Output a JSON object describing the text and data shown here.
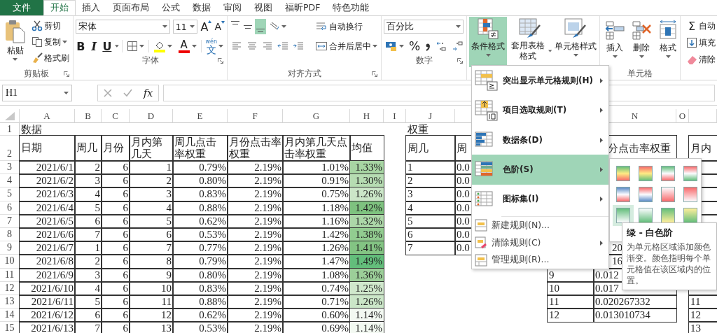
{
  "tabs": [
    {
      "label": "文件",
      "kind": "file",
      "selected": false
    },
    {
      "label": "开始",
      "selected": true
    },
    {
      "label": "插入",
      "selected": false
    },
    {
      "label": "页面布局",
      "selected": false
    },
    {
      "label": "公式",
      "selected": false
    },
    {
      "label": "数据",
      "selected": false
    },
    {
      "label": "审阅",
      "selected": false
    },
    {
      "label": "视图",
      "selected": false
    },
    {
      "label": "福昕PDF",
      "selected": false
    },
    {
      "label": "特色功能",
      "selected": false
    }
  ],
  "clipboard": {
    "paste": "粘贴",
    "cut": "剪切",
    "copy": "复制",
    "painter": "格式刷",
    "label": "剪贴板"
  },
  "font": {
    "name": "宋体",
    "size": "11",
    "grow": "A",
    "shrink": "A",
    "bold": "B",
    "italic": "I",
    "underline": "U",
    "color_letter": "A",
    "phonetic_top": "wén",
    "phonetic_main": "文",
    "label": "字体"
  },
  "alignment": {
    "wrap": "自动换行",
    "merge": "合并后居中",
    "label": "对齐方式"
  },
  "number": {
    "format": "百分比",
    "percent": "%",
    "label": "数字"
  },
  "styles": {
    "conditional": {
      "label": "条件格式",
      "selected": true
    },
    "table_format": "套用表格格式",
    "cell_styles": "单元格样式"
  },
  "cells": {
    "insert": "插入",
    "delete": "删除",
    "format": "格式",
    "label": "单元格"
  },
  "editing": {
    "sum_symbol": "Σ",
    "items": [
      "自动",
      "填充",
      "清除"
    ]
  },
  "formula_bar": {
    "name_box": "H1",
    "fx": "fx"
  },
  "sheet": {
    "column_headers": [
      "A",
      "B",
      "C",
      "D",
      "E",
      "F",
      "G",
      "H",
      "I",
      "J"
    ],
    "column_headers_right": [
      "N",
      "O"
    ],
    "row_numbers": [
      "1",
      "2",
      "3",
      "4",
      "5",
      "6",
      "7",
      "8",
      "9",
      "10",
      "11",
      "12",
      "13",
      "14",
      "15"
    ],
    "data_title": "数据",
    "data_table": {
      "headers": [
        "日期",
        "周几",
        "月份",
        "月内第几天",
        "周几点击率权重",
        "月份点击率权重",
        "月内第几天点击率权重",
        "均值"
      ],
      "rows": [
        {
          "cells": [
            "2021/6/1",
            "2",
            "6",
            "1",
            "0.79%",
            "2.19%",
            "1.01%"
          ],
          "mean": "1.33%",
          "color": "#a7d5a3"
        },
        {
          "cells": [
            "2021/6/2",
            "3",
            "6",
            "2",
            "0.80%",
            "2.19%",
            "0.91%"
          ],
          "mean": "1.30%",
          "color": "#b6dcb2"
        },
        {
          "cells": [
            "2021/6/3",
            "4",
            "6",
            "3",
            "0.83%",
            "2.19%",
            "0.75%"
          ],
          "mean": "1.26%",
          "color": "#cbe6c8"
        },
        {
          "cells": [
            "2021/6/4",
            "5",
            "6",
            "4",
            "0.88%",
            "2.19%",
            "1.18%"
          ],
          "mean": "1.42%",
          "color": "#7ec27f"
        },
        {
          "cells": [
            "2021/6/5",
            "6",
            "6",
            "5",
            "0.62%",
            "2.19%",
            "1.16%"
          ],
          "mean": "1.32%",
          "color": "#acd7a8"
        },
        {
          "cells": [
            "2021/6/6",
            "7",
            "6",
            "6",
            "0.53%",
            "2.19%",
            "1.42%"
          ],
          "mean": "1.38%",
          "color": "#92cc90"
        },
        {
          "cells": [
            "2021/6/7",
            "1",
            "6",
            "7",
            "0.77%",
            "2.19%",
            "1.26%"
          ],
          "mean": "1.41%",
          "color": "#83c483"
        },
        {
          "cells": [
            "2021/6/8",
            "2",
            "6",
            "8",
            "0.79%",
            "2.19%",
            "1.47%"
          ],
          "mean": "1.49%",
          "color": "#63be7b"
        },
        {
          "cells": [
            "2021/6/9",
            "3",
            "6",
            "9",
            "0.80%",
            "2.19%",
            "1.08%"
          ],
          "mean": "1.36%",
          "color": "#9ccf99"
        },
        {
          "cells": [
            "2021/6/10",
            "4",
            "6",
            "10",
            "0.83%",
            "2.19%",
            "0.74%"
          ],
          "mean": "1.25%",
          "color": "#d0e8cc"
        },
        {
          "cells": [
            "2021/6/11",
            "5",
            "6",
            "11",
            "0.88%",
            "2.19%",
            "0.71%"
          ],
          "mean": "1.26%",
          "color": "#cbe6c8"
        },
        {
          "cells": [
            "2021/6/12",
            "6",
            "6",
            "12",
            "0.62%",
            "2.19%",
            "0.60%"
          ],
          "mean": "1.14%",
          "color": "#f3f9f2"
        },
        {
          "cells": [
            "2021/6/13",
            "7",
            "6",
            "13",
            "0.53%",
            "2.19%",
            "0.69%"
          ],
          "mean": "1.14%",
          "color": "#f3f9f2"
        }
      ]
    },
    "weight_title": "权重",
    "weight_table": {
      "headers": [
        "周几",
        "周"
      ],
      "rows": [
        [
          "1",
          "0.0"
        ],
        [
          "2",
          "0.0"
        ],
        [
          "3",
          "0.0"
        ],
        [
          "4",
          "0.0"
        ],
        [
          "5",
          "0.0"
        ],
        [
          "6",
          "0.0"
        ],
        [
          "7",
          "0.0"
        ]
      ]
    },
    "day_table": {
      "header": "分点击率权重",
      "rows": [
        {
          "value": "20"
        },
        {
          "value": "16"
        },
        {
          "label": "9",
          "value": "0.012"
        },
        {
          "label": "10",
          "value": "0.017"
        },
        {
          "label": "11",
          "value": "0.020267332"
        },
        {
          "label": "12",
          "value": "0.013010734"
        }
      ]
    },
    "third_table": {
      "header": "月内",
      "rows": [
        "11",
        "12",
        "13"
      ]
    }
  },
  "menu": {
    "items": [
      {
        "label": "突出显示单元格规则(H)",
        "kind": "large",
        "submenu": true,
        "selected": false
      },
      {
        "label": "项目选取规则(T)",
        "kind": "large",
        "submenu": true,
        "selected": false
      },
      {
        "label": "数据条(D)",
        "kind": "large",
        "submenu": true,
        "selected": false
      },
      {
        "label": "色阶(S)",
        "kind": "large",
        "submenu": true,
        "selected": true
      },
      {
        "label": "图标集(I)",
        "kind": "large",
        "submenu": true,
        "selected": false
      },
      {
        "label": "新建规则(N)...",
        "kind": "small",
        "submenu": false,
        "selected": false
      },
      {
        "label": "清除规则(C)",
        "kind": "small",
        "submenu": true,
        "selected": false
      },
      {
        "label": "管理规则(R)...",
        "kind": "small",
        "submenu": false,
        "selected": false
      }
    ]
  },
  "color_scales": [
    {
      "selected": false
    },
    {
      "selected": false
    },
    {
      "selected": false
    },
    {
      "selected": false
    },
    {
      "selected": false
    },
    {
      "selected": false
    },
    {
      "selected": false
    },
    {
      "selected": false
    },
    {
      "selected": true
    },
    {
      "selected": false
    },
    {
      "selected": false
    },
    {
      "selected": false
    }
  ],
  "tooltip": {
    "title": "绿 - 白色阶",
    "body": "为单元格区域添加颜色渐变。颜色指明每个单元格值在该区域内的位置。"
  }
}
